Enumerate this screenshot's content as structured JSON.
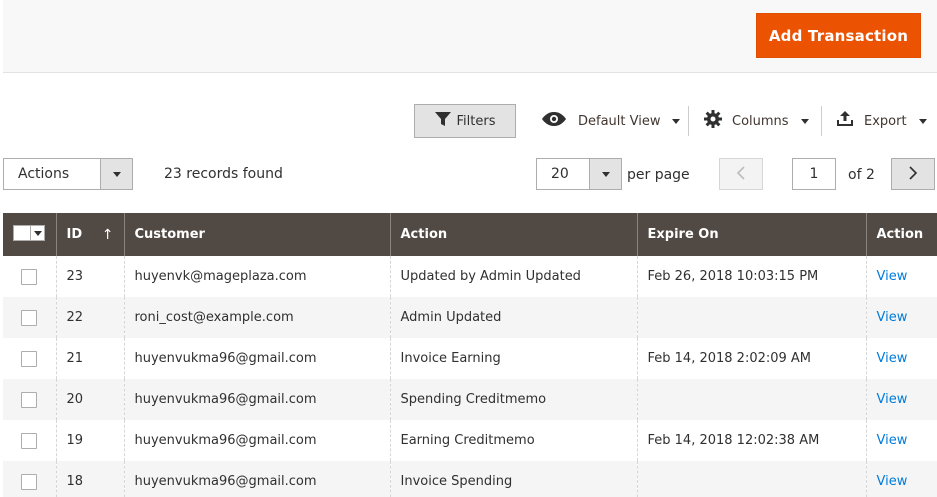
{
  "header": {
    "add_button_label": "Add Transaction"
  },
  "toolbar": {
    "filters_label": "Filters",
    "view_label": "Default View",
    "columns_label": "Columns",
    "export_label": "Export"
  },
  "grid_controls": {
    "actions_label": "Actions",
    "records_found": "23 records found",
    "per_page_value": "20",
    "per_page_label": "per page",
    "current_page": "1",
    "of_pages": "of 2"
  },
  "table": {
    "columns": [
      "ID",
      "Customer",
      "Action",
      "Expire On",
      "Action"
    ],
    "rows": [
      {
        "id": "23",
        "customer": "huyenvk@mageplaza.com",
        "action": "Updated by Admin Updated",
        "expire": "Feb 26, 2018 10:03:15 PM",
        "link": "View"
      },
      {
        "id": "22",
        "customer": "roni_cost@example.com",
        "action": "Admin Updated",
        "expire": "",
        "link": "View"
      },
      {
        "id": "21",
        "customer": "huyenvukma96@gmail.com",
        "action": "Invoice Earning",
        "expire": "Feb 14, 2018 2:02:09 AM",
        "link": "View"
      },
      {
        "id": "20",
        "customer": "huyenvukma96@gmail.com",
        "action": "Spending Creditmemo",
        "expire": "",
        "link": "View"
      },
      {
        "id": "19",
        "customer": "huyenvukma96@gmail.com",
        "action": "Earning Creditmemo",
        "expire": "Feb 14, 2018 12:02:38 AM",
        "link": "View"
      },
      {
        "id": "18",
        "customer": "huyenvukma96@gmail.com",
        "action": "Invoice Spending",
        "expire": "",
        "link": "View"
      }
    ]
  },
  "colors": {
    "primary": "#eb5202",
    "header_bg": "#514943",
    "link": "#007bdb"
  },
  "icons": [
    "filter-icon",
    "eye-icon",
    "gear-icon",
    "export-icon",
    "chevron-left-icon",
    "chevron-right-icon",
    "sort-up-arrow-icon"
  ]
}
